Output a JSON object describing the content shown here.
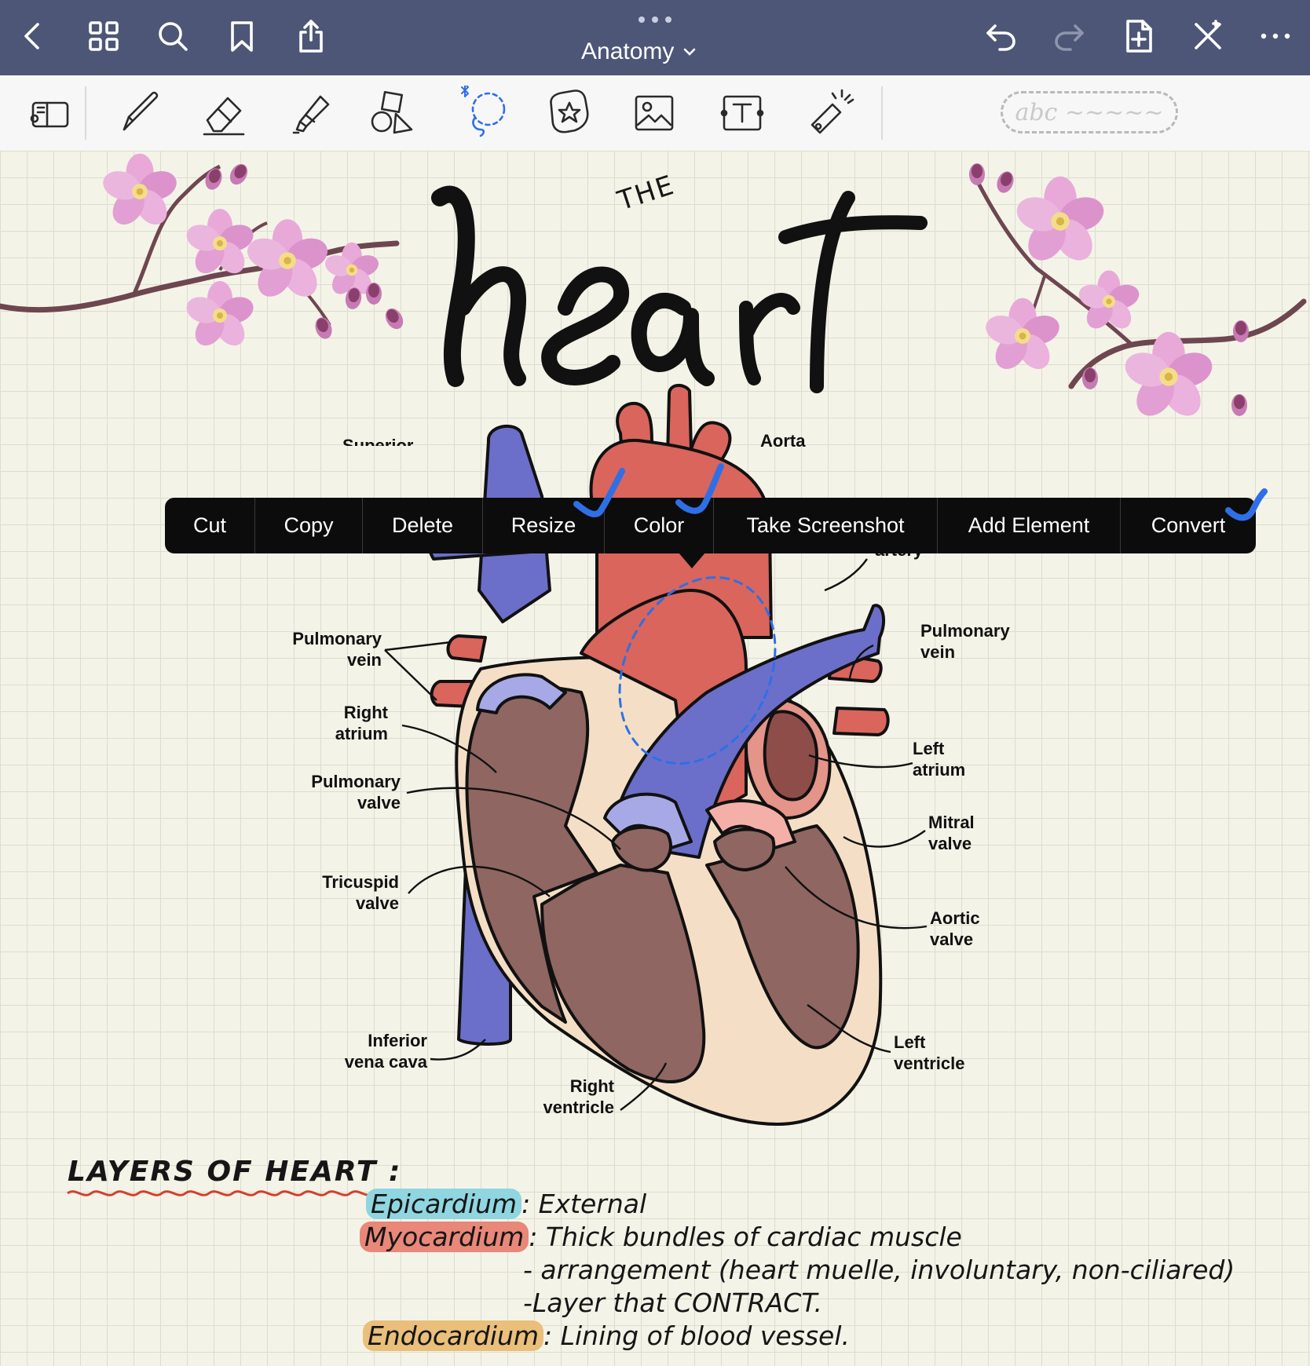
{
  "app": {
    "accent": "#4d5677"
  },
  "topbar": {
    "title": "Anatomy",
    "left_icons": [
      "back-icon",
      "grid-icon",
      "search-icon",
      "bookmark-icon",
      "share-icon"
    ],
    "right_icons": [
      "undo-icon",
      "redo-icon",
      "add-page-icon",
      "close-pen-icon",
      "more-icon"
    ]
  },
  "toolbar": {
    "tools": [
      "tools-sidebar",
      "pen",
      "eraser",
      "highlighter",
      "shapes",
      "lasso",
      "stickers",
      "image",
      "text",
      "laser-pointer"
    ],
    "active_tool": "lasso",
    "handwriting_placeholder": "abc ~~~~~"
  },
  "page": {
    "title_small": "THE",
    "title_large": "heart"
  },
  "diagram": {
    "labels": {
      "superior_vena_cava": "Superior",
      "aorta": "Aorta",
      "pulmonary_artery": "artery",
      "pulmonary_vein_left": [
        "Pulmonary",
        "vein"
      ],
      "right_atrium": [
        "Right",
        "atrium"
      ],
      "pulmonary_valve": [
        "Pulmonary",
        "valve"
      ],
      "tricuspid_valve": [
        "Tricuspid",
        "valve"
      ],
      "inferior_vena_cava": [
        "Inferior",
        "vena cava"
      ],
      "right_ventricle": [
        "Right",
        "ventricle"
      ],
      "pulmonary_vein_right": [
        "Pulmonary",
        "vein"
      ],
      "left_atrium": [
        "Left",
        "atrium"
      ],
      "mitral_valve": [
        "Mitral",
        "valve"
      ],
      "aortic_valve": [
        "Aortic",
        "valve"
      ],
      "left_ventricle": [
        "Left",
        "ventricle"
      ]
    },
    "colors": {
      "vein_blue": "#6b6fc9",
      "artery_red": "#d9655c",
      "muscle": "#8f6661",
      "wall": "#f4dfc6"
    }
  },
  "context_menu": {
    "items": [
      "Cut",
      "Copy",
      "Delete",
      "Resize",
      "Color",
      "Take Screenshot",
      "Add Element",
      "Convert"
    ]
  },
  "notes": {
    "heading": "LAYERS OF HEART :",
    "lines": [
      {
        "term": "Epicardium",
        "text": ": External",
        "color": "#8fd6e0"
      },
      {
        "term": "Myocardium",
        "text": ": Thick bundles of cardiac muscle",
        "color": "#e98778"
      },
      {
        "term": "",
        "text": "- arrangement (heart muelle, involuntary, non-ciliared)",
        "color": ""
      },
      {
        "term": "",
        "text": "-Layer that CONTRACT.",
        "color": ""
      },
      {
        "term": "Endocardium",
        "text": ": Lining of blood vessel.",
        "color": "#e9bf7a"
      }
    ]
  }
}
